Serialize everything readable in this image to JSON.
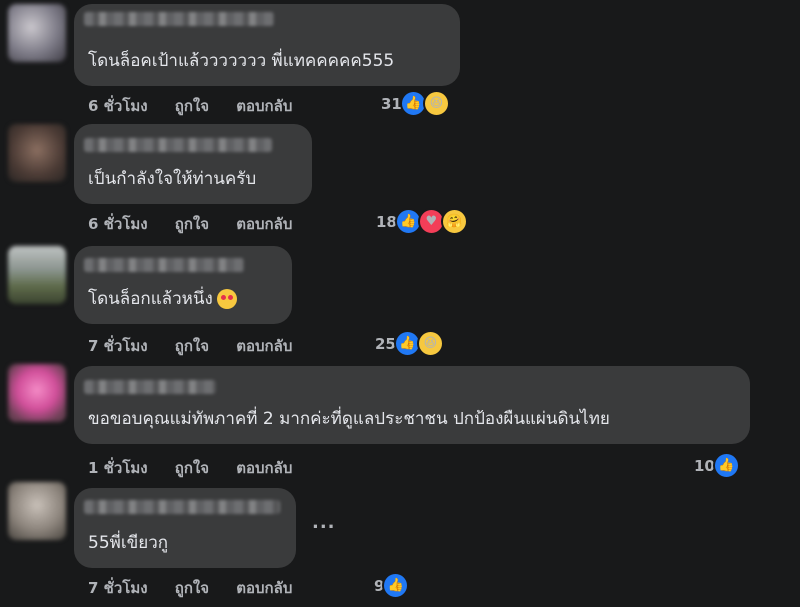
{
  "comments": [
    {
      "text": "โดนล็อคเป้าแล้ววววววว พี่แทคคคคค555",
      "time": "6 ชั่วโมง",
      "like_label": "ถูกใจ",
      "reply_label": "ตอบกลับ",
      "reaction_count": "31",
      "reactions": [
        "like-icon",
        "haha-icon"
      ]
    },
    {
      "text": "เป็นกำลังใจให้ท่านครับ",
      "time": "6 ชั่วโมง",
      "like_label": "ถูกใจ",
      "reply_label": "ตอบกลับ",
      "reaction_count": "18",
      "reactions": [
        "like-icon",
        "love-icon",
        "care-icon"
      ]
    },
    {
      "text": "โดนล็อกแล้วหนึ่ง",
      "emoji": "heart-eyes-emoji",
      "time": "7 ชั่วโมง",
      "like_label": "ถูกใจ",
      "reply_label": "ตอบกลับ",
      "reaction_count": "25",
      "reactions": [
        "like-icon",
        "haha-icon"
      ]
    },
    {
      "text": "ขอขอบคุณแม่ทัพภาคที่ 2 มากค่ะที่ดูแลประชาชน ปกป้องผืนแผ่นดินไทย",
      "time": "1 ชั่วโมง",
      "like_label": "ถูกใจ",
      "reply_label": "ตอบกลับ",
      "reaction_count": "10",
      "reactions": [
        "like-icon"
      ]
    },
    {
      "text": "55พี่เขียวกู",
      "time": "7 ชั่วโมง",
      "like_label": "ถูกใจ",
      "reply_label": "ตอบกลับ",
      "reaction_count": "9",
      "reactions": [
        "like-icon"
      ]
    }
  ],
  "more_options": "...",
  "colors": {
    "background": "#18191a",
    "bubble": "#3a3b3c",
    "text": "#e4e6eb",
    "secondary_text": "#b0b3b8",
    "like": "#2078f4"
  }
}
